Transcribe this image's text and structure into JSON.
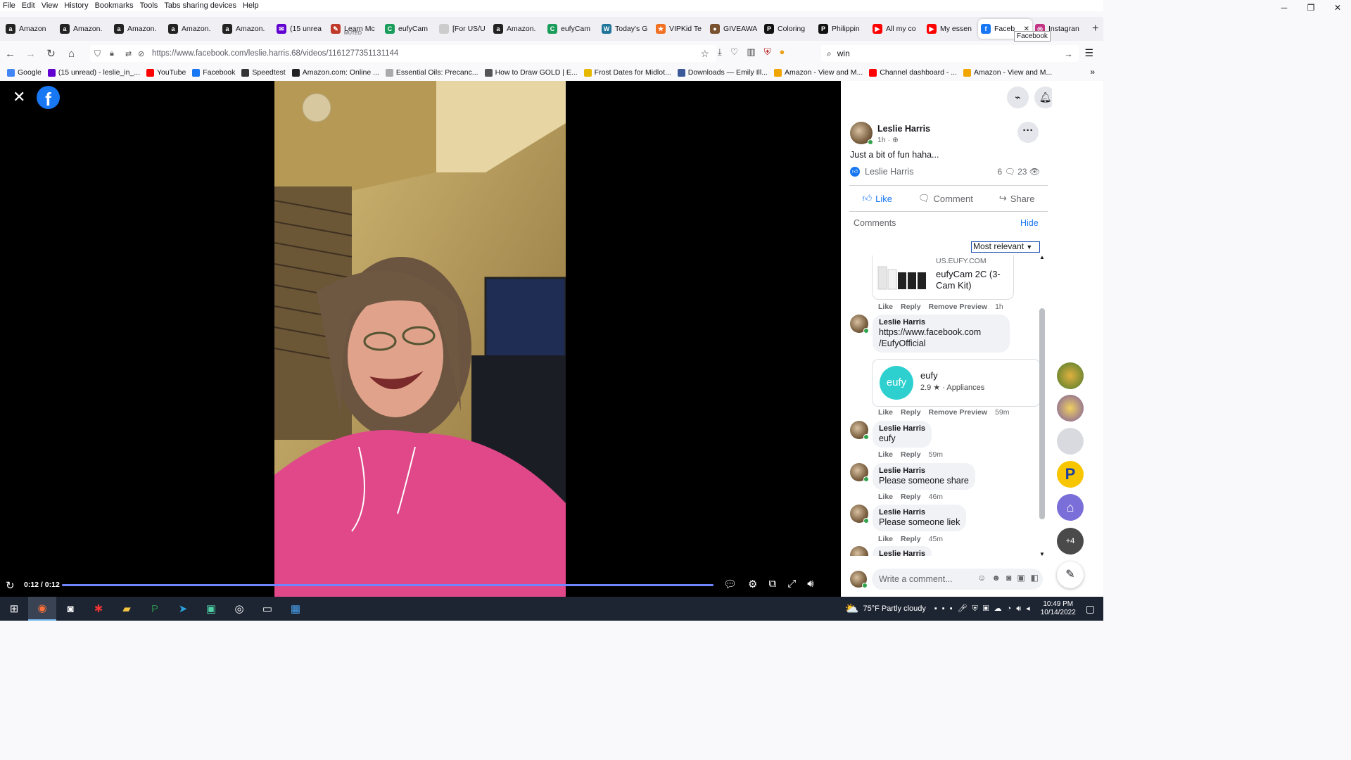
{
  "menu": [
    "File",
    "Edit",
    "View",
    "History",
    "Bookmarks",
    "Tools",
    "Tabs sharing devices",
    "Help"
  ],
  "tabs": [
    {
      "label": "Amazon",
      "color": "#222",
      "glyph": "a"
    },
    {
      "label": "Amazon.",
      "color": "#222",
      "glyph": "a"
    },
    {
      "label": "Amazon.",
      "color": "#222",
      "glyph": "a"
    },
    {
      "label": "Amazon.",
      "color": "#222",
      "glyph": "a"
    },
    {
      "label": "Amazon.",
      "color": "#222",
      "glyph": "a"
    },
    {
      "label": "(15 unrea",
      "color": "#6001d2",
      "glyph": "✉"
    },
    {
      "label": "Learn Mc",
      "color": "#c0392b",
      "glyph": "✎",
      "muted": "MUTED"
    },
    {
      "label": "eufyCam",
      "color": "#1a9c5b",
      "glyph": "C"
    },
    {
      "label": "[For US/U",
      "color": "#ccc",
      "glyph": ""
    },
    {
      "label": "Amazon.",
      "color": "#222",
      "glyph": "a"
    },
    {
      "label": "eufyCam",
      "color": "#1a9c5b",
      "glyph": "C"
    },
    {
      "label": "Today's G",
      "color": "#21759b",
      "glyph": "W"
    },
    {
      "label": "VIPKid Te",
      "color": "#f27022",
      "glyph": "★"
    },
    {
      "label": "GIVEAWA",
      "color": "#7a5230",
      "glyph": "●"
    },
    {
      "label": "Coloring",
      "color": "#111",
      "glyph": "P"
    },
    {
      "label": "Philippin",
      "color": "#111",
      "glyph": "P"
    },
    {
      "label": "All my co",
      "color": "#ff0000",
      "glyph": "▶"
    },
    {
      "label": "My essen",
      "color": "#ff0000",
      "glyph": "▶"
    },
    {
      "label": "Faceb",
      "color": "#1877f2",
      "glyph": "f",
      "active": true
    },
    {
      "label": "Instagran",
      "color": "#c13584",
      "glyph": "◎"
    }
  ],
  "tab_tooltip": "Facebook",
  "url": "https://www.facebook.com/leslie.harris.68/videos/1161277351131144",
  "search_value": "win",
  "bookmarks": [
    {
      "label": "Google",
      "color": "#4285f4"
    },
    {
      "label": "(15 unread) - leslie_in_...",
      "color": "#6001d2"
    },
    {
      "label": "YouTube",
      "color": "#ff0000"
    },
    {
      "label": "Facebook",
      "color": "#1877f2"
    },
    {
      "label": "Speedtest",
      "color": "#333"
    },
    {
      "label": "Amazon.com: Online ...",
      "color": "#222"
    },
    {
      "label": "Essential Oils: Precanc...",
      "color": "#aaa"
    },
    {
      "label": "How to Draw GOLD | E...",
      "color": "#555"
    },
    {
      "label": "Frost Dates for Midlot...",
      "color": "#e6b800"
    },
    {
      "label": "Downloads — Emily Ill...",
      "color": "#3b5998"
    },
    {
      "label": "Amazon - View and M...",
      "color": "#f0a500"
    },
    {
      "label": "Channel dashboard - ...",
      "color": "#ff0000"
    },
    {
      "label": "Amazon - View and M...",
      "color": "#f0a500"
    }
  ],
  "video": {
    "time": "0:12 / 0:12",
    "progress": 1.0
  },
  "post": {
    "author": "Leslie Harris",
    "time": "1h ·",
    "text": "Just a bit of fun haha...",
    "reactor": "Leslie Harris",
    "comments_count": "6",
    "views_count": "23",
    "like_label": "Like",
    "comment_label": "Comment",
    "share_label": "Share"
  },
  "comments_header": "Comments",
  "hide_label": "Hide",
  "sort_label": "Most relevant",
  "link_preview": {
    "domain": "US.EUFY.COM",
    "title": "eufyCam 2C (3-Cam Kit)"
  },
  "comments": [
    {
      "meta": {
        "like": "Like",
        "reply": "Reply",
        "extra": "Remove Preview",
        "time": "1h"
      }
    },
    {
      "name": "Leslie Harris",
      "text": "https://www.facebook.com /EufyOfficial",
      "meta": {
        "like": "Like",
        "reply": "Reply",
        "extra": "Remove Preview",
        "time": "59m"
      }
    },
    {
      "name": "Leslie Harris",
      "text": "eufy",
      "meta": {
        "like": "Like",
        "reply": "Reply",
        "time": "59m"
      }
    },
    {
      "name": "Leslie Harris",
      "text": "Please someone share",
      "meta": {
        "like": "Like",
        "reply": "Reply",
        "time": "46m"
      }
    },
    {
      "name": "Leslie Harris",
      "text": "Please someone liek",
      "meta": {
        "like": "Like",
        "reply": "Reply",
        "time": "45m"
      }
    },
    {
      "name": "Leslie Harris"
    }
  ],
  "page_card": {
    "name": "eufy",
    "rating": "2.9",
    "category": "Appliances",
    "logo_text": "eufy"
  },
  "comment_placeholder": "Write a comment...",
  "contacts_more": "+4",
  "taskbar": {
    "weather": "75°F  Partly cloudy",
    "time": "10:49 PM",
    "date": "10/14/2022"
  }
}
